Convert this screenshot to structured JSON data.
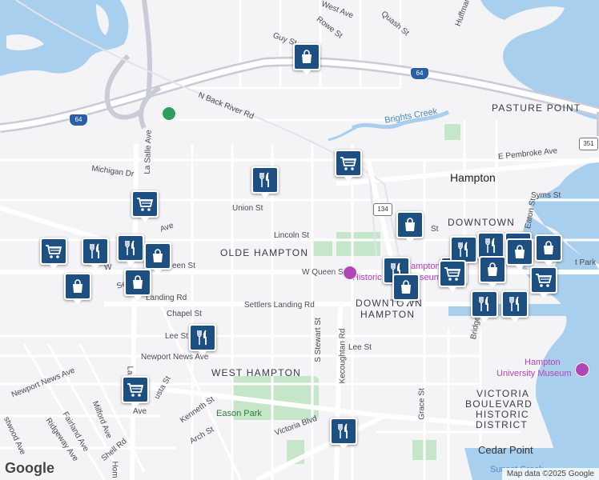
{
  "streets": {
    "west_ave": "West Ave",
    "rowe_st": "Rowe St",
    "quash_st": "Quash St",
    "guy_st": "Guy St",
    "huffman": "Huffman",
    "n_back_river_rd": "N Back River Rd",
    "la_salle_ave": "La Salle Ave",
    "michigan_dr": "Michigan Dr",
    "union_st": "Union St",
    "lincoln_st": "Lincoln St",
    "w_queen_st": "W Queen St",
    "queen_st_fragment": "een St",
    "settlers_landing_rd": "Settlers Landing Rd",
    "settlers_fragment": "Se",
    "settlers_landing_fragment": "Landing Rd",
    "chapel_st": "Chapel St",
    "lee_st": "Lee St",
    "lee_st_east": "Lee St",
    "newport_news_ave": "Newport News Ave",
    "newport_news_ave_west": "Newport News Ave",
    "augusta_fragment": "usta St",
    "kenneth_st": "Kenneth St",
    "arch_st": "Arch St",
    "victoria_blvd": "Victoria Blvd",
    "s_stewart_st": "S Stewart St",
    "kecoughtan_rd": "Kecoughtan Rd",
    "grace_st": "Grace St",
    "e_pembroke_ave": "E Pembroke Ave",
    "syms_st": "Syms St",
    "eaton_st": "Eaton St",
    "bridge_fragment": "Bridge",
    "shell_rd": "Shell Rd",
    "milford_ave": "Milford Ave",
    "fairland_ave": "Fairland Ave",
    "ridgeway_ave": "Ridgeway Ave",
    "wood_ave_fragment": "stwood Ave",
    "hom_fragment": "Hom",
    "la_fragment": "La",
    "ave_fragment": "Ave",
    "ave_fragment2": "Ave",
    "st_fragment": "St",
    "w_fragment": "W"
  },
  "places": {
    "pasture_point": "PASTURE POINT",
    "hampton": "Hampton",
    "downtown": "DOWNTOWN",
    "olde_hampton": "OLDE HAMPTON",
    "downtown_hampton_1": "DOWNTOWN",
    "downtown_hampton_2": "HAMPTON",
    "west_hampton": "WEST HAMPTON",
    "victoria_1": "VICTORIA",
    "victoria_2": "BOULEVARD",
    "victoria_3": "HISTORIC",
    "victoria_4": "DISTRICT",
    "cedar_point": "Cedar Point",
    "brights_creek": "Brights Creek",
    "eason_park": "Eason Park",
    "historic_museum_1": "Historic",
    "historic_museum_2": "Hampton",
    "historic_museum_3": "seum",
    "hampton_university_museum_1": "Hampton",
    "hampton_university_museum_2": "University Museum",
    "park_fragment": "t Park",
    "sunset_fragment": "Sunset Creek"
  },
  "shields": {
    "i64_north": "64",
    "i64_west": "64",
    "route_134": "134",
    "route_351": "351"
  },
  "markers": [
    {
      "type": "shopping",
      "icon": "shopping-bag-icon"
    },
    {
      "type": "grocery",
      "icon": "shopping-cart-icon"
    },
    {
      "type": "restaurant",
      "icon": "fork-knife-icon"
    },
    {
      "type": "grocery",
      "icon": "shopping-cart-icon"
    },
    {
      "type": "grocery",
      "icon": "shopping-cart-icon"
    },
    {
      "type": "restaurant",
      "icon": "fork-knife-icon"
    },
    {
      "type": "restaurant",
      "icon": "fork-knife-icon"
    },
    {
      "type": "shopping",
      "icon": "shopping-bag-icon"
    },
    {
      "type": "shopping",
      "icon": "shopping-bag-icon"
    },
    {
      "type": "shopping",
      "icon": "shopping-bag-icon"
    },
    {
      "type": "restaurant",
      "icon": "fork-knife-icon"
    },
    {
      "type": "grocery",
      "icon": "shopping-cart-icon"
    },
    {
      "type": "shopping",
      "icon": "shopping-bag-icon"
    },
    {
      "type": "restaurant",
      "icon": "fork-knife-icon"
    },
    {
      "type": "shopping",
      "icon": "shopping-bag-icon"
    },
    {
      "type": "restaurant",
      "icon": "fork-knife-icon"
    },
    {
      "type": "grocery",
      "icon": "shopping-cart-icon"
    },
    {
      "type": "restaurant",
      "icon": "fork-knife-icon"
    },
    {
      "type": "shopping",
      "icon": "shopping-bag-icon"
    },
    {
      "type": "shopping",
      "icon": "shopping-bag-icon"
    },
    {
      "type": "shopping",
      "icon": "shopping-bag-icon"
    },
    {
      "type": "grocery",
      "icon": "shopping-cart-icon"
    },
    {
      "type": "restaurant",
      "icon": "fork-knife-icon"
    },
    {
      "type": "restaurant",
      "icon": "fork-knife-icon"
    },
    {
      "type": "restaurant",
      "icon": "fork-knife-icon"
    },
    {
      "type": "grocery",
      "icon": "shopping-cart-icon"
    },
    {
      "type": "restaurant",
      "icon": "fork-knife-icon"
    }
  ],
  "colors": {
    "marker": "#1e4f81",
    "water": "#a9cfee",
    "park": "#c5e6c9",
    "road": "#ffffff",
    "highway": "#c9ccd6"
  },
  "attribution": {
    "logo": "Google",
    "text": "Map data ©2025 Google"
  }
}
